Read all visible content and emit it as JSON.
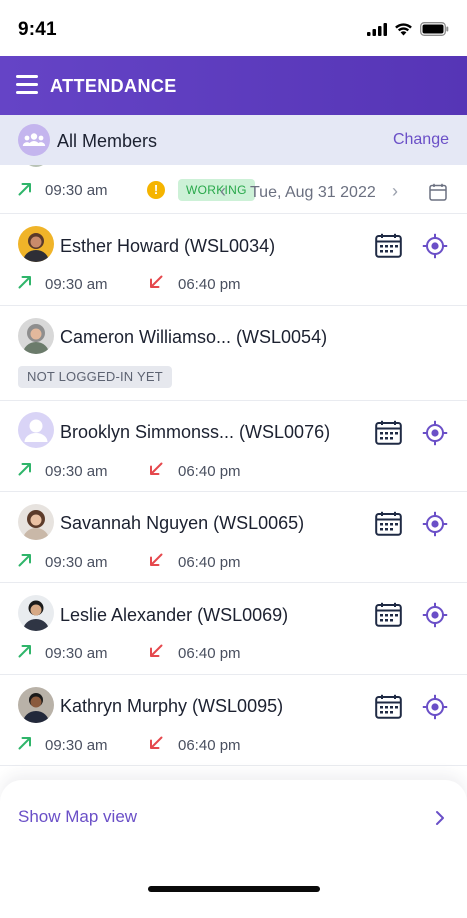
{
  "status_bar": {
    "time": "9:41"
  },
  "header": {
    "title": "ATTENDANCE"
  },
  "filter": {
    "label": "All Members",
    "change_label": "Change"
  },
  "partial_row": {
    "in_time": "09:30 am",
    "status": "WORKING",
    "date": "Tue, Aug 31 2022"
  },
  "members": [
    {
      "name": "Esther Howard (WSL0034)",
      "in_time": "09:30 am",
      "out_time": "06:40 pm"
    },
    {
      "name": "Cameron Williamso... (WSL0054)",
      "status": "NOT LOGGED-IN YET"
    },
    {
      "name": "Brooklyn Simmonss... (WSL0076)",
      "in_time": "09:30 am",
      "out_time": "06:40 pm"
    },
    {
      "name": "Savannah Nguyen (WSL0065)",
      "in_time": "09:30 am",
      "out_time": "06:40 pm"
    },
    {
      "name": "Leslie Alexander (WSL0069)",
      "in_time": "09:30 am",
      "out_time": "06:40 pm"
    },
    {
      "name": "Kathryn Murphy (WSL0095)",
      "in_time": "09:30 am",
      "out_time": "06:40 pm"
    }
  ],
  "bottom": {
    "map_link": "Show Map view"
  },
  "icons": {
    "menu": "menu-icon",
    "group": "group-icon",
    "check_in": "arrow-up-right-icon",
    "check_out": "arrow-down-left-icon",
    "warning": "warning-icon",
    "calendar": "calendar-icon",
    "schedule": "schedule-icon",
    "location": "location-target-icon",
    "chevron": "chevron-right-icon"
  },
  "colors": {
    "brand": "#5a3bbd",
    "accent": "#6a4fc7",
    "check_in": "#2fb56a",
    "check_out": "#e5484d",
    "working_bg": "#cdf1d7",
    "working_text": "#28a84a"
  }
}
